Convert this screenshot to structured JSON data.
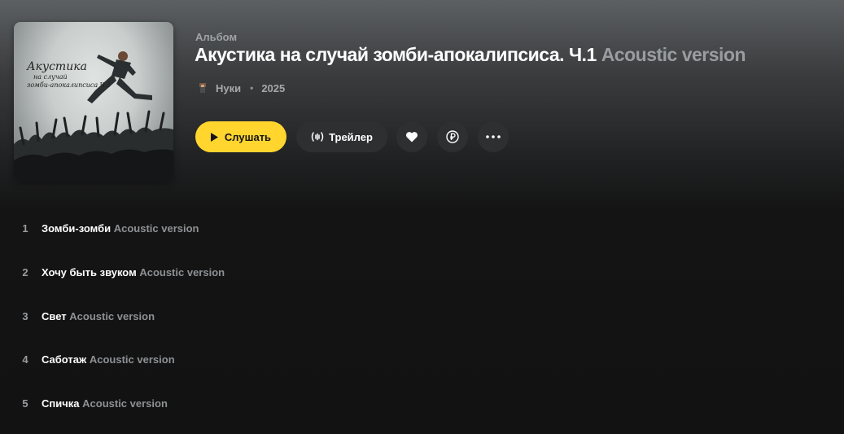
{
  "album": {
    "type_label": "Альбом",
    "title": "Акустика на случай зомби-апокалипсиса. Ч.1",
    "title_version": "Acoustic version",
    "artist": "Нуки",
    "year": "2025",
    "cover_text": {
      "line1": "Акустика",
      "line2": "на случай",
      "line3": "зомби-апокалипсиса Ч.1"
    }
  },
  "actions": {
    "play_label": "Слушать",
    "trailer_label": "Трейлер",
    "play_color": "#ffd52e",
    "icons": [
      "play-icon",
      "waveform-icon",
      "heart-icon",
      "ruble-icon",
      "more-dots-icon"
    ]
  },
  "tracks": [
    {
      "num": "1",
      "name": "Зомби-зомби",
      "version": "Acoustic version"
    },
    {
      "num": "2",
      "name": "Хочу быть звуком",
      "version": "Acoustic version"
    },
    {
      "num": "3",
      "name": "Свет",
      "version": "Acoustic version"
    },
    {
      "num": "4",
      "name": "Саботаж",
      "version": "Acoustic version"
    },
    {
      "num": "5",
      "name": "Спичка",
      "version": "Acoustic version"
    }
  ]
}
